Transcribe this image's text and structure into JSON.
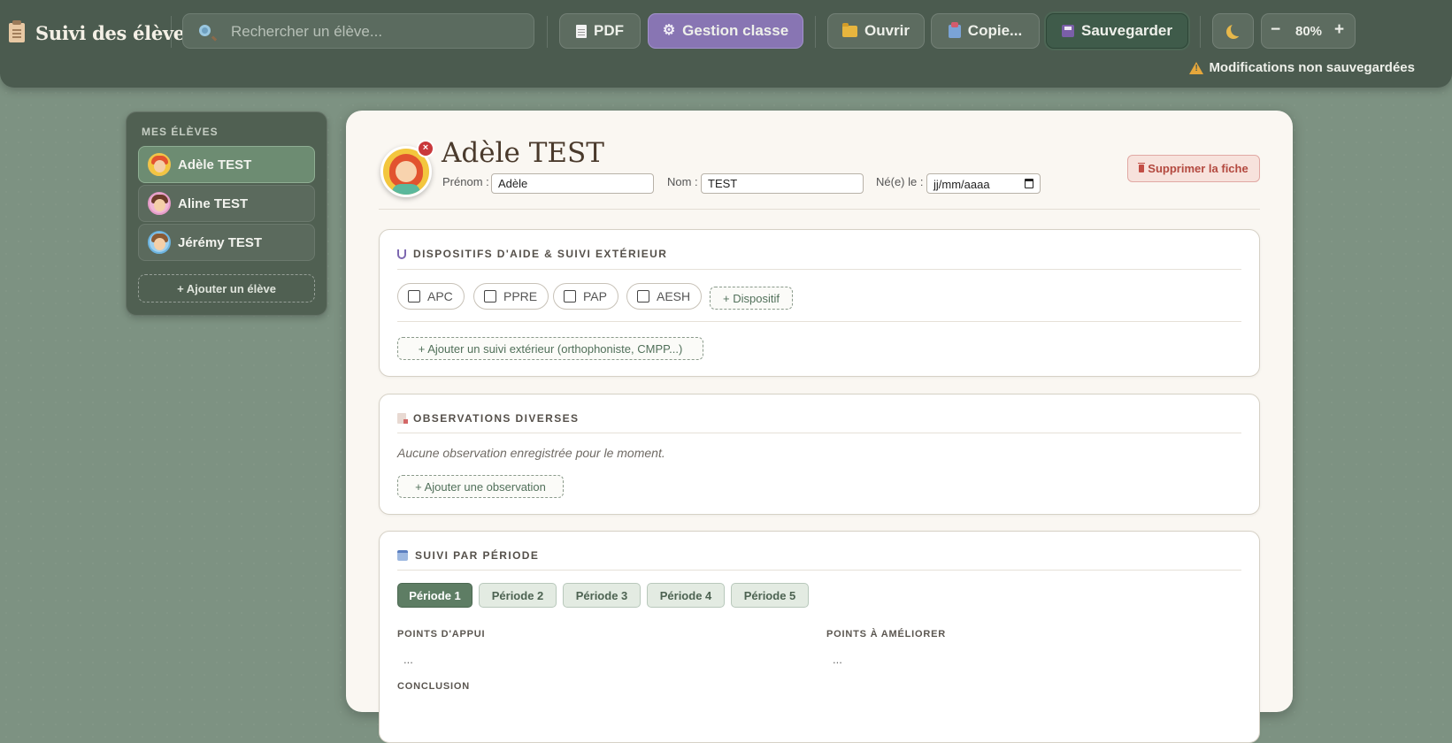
{
  "app": {
    "title": "Suivi des élèves",
    "icon": "clipboard-icon"
  },
  "toolbar": {
    "search_placeholder": "Rechercher un élève...",
    "pdf_label": "PDF",
    "class_management_label": "Gestion classe",
    "open_label": "Ouvrir",
    "copy_label": "Copie...",
    "save_label": "Sauvegarder",
    "zoom_minus": "−",
    "zoom_value": "80%",
    "zoom_plus": "+",
    "unsaved_message": "Modifications non sauvegardées",
    "accent_color": "#8875b3"
  },
  "sidebar": {
    "title": "MES ÉLÈVES",
    "students": [
      {
        "name": "Adèle TEST",
        "active": true,
        "hair": "#e2532f"
      },
      {
        "name": "Aline TEST",
        "active": false,
        "hair": "#6b3b2a"
      },
      {
        "name": "Jérémy TEST",
        "active": false,
        "hair": "#8a5a35"
      }
    ],
    "add_label": "+ Ajouter un élève"
  },
  "student": {
    "full_name": "Adèle TEST",
    "remove_photo": "×",
    "first_name_label": "Prénom :",
    "first_name": "Adèle",
    "last_name_label": "Nom :",
    "last_name": "TEST",
    "birth_label": "Né(e) le :",
    "birth_placeholder": "jj/mm/aaaa",
    "delete_label": "Supprimer la fiche"
  },
  "aids": {
    "title": "DISPOSITIFS D'AIDE & SUIVI EXTÉRIEUR",
    "options": [
      "APC",
      "PPRE",
      "PAP",
      "AESH"
    ],
    "add_device_label": "+ Dispositif",
    "add_external_label": "+ Ajouter un suivi extérieur (orthophoniste, CMPP...)"
  },
  "observations": {
    "title": "OBSERVATIONS DIVERSES",
    "empty_text": "Aucune observation enregistrée pour le moment.",
    "add_label": "+ Ajouter une observation"
  },
  "periods": {
    "title": "SUIVI PAR PÉRIODE",
    "tabs": [
      "Période 1",
      "Période 2",
      "Période 3",
      "Période 4",
      "Période 5"
    ],
    "active_tab": 0,
    "strengths_label": "POINTS D'APPUI",
    "strengths_value": "...",
    "improvements_label": "POINTS À AMÉLIORER",
    "improvements_value": "...",
    "conclusion_label": "CONCLUSION"
  }
}
